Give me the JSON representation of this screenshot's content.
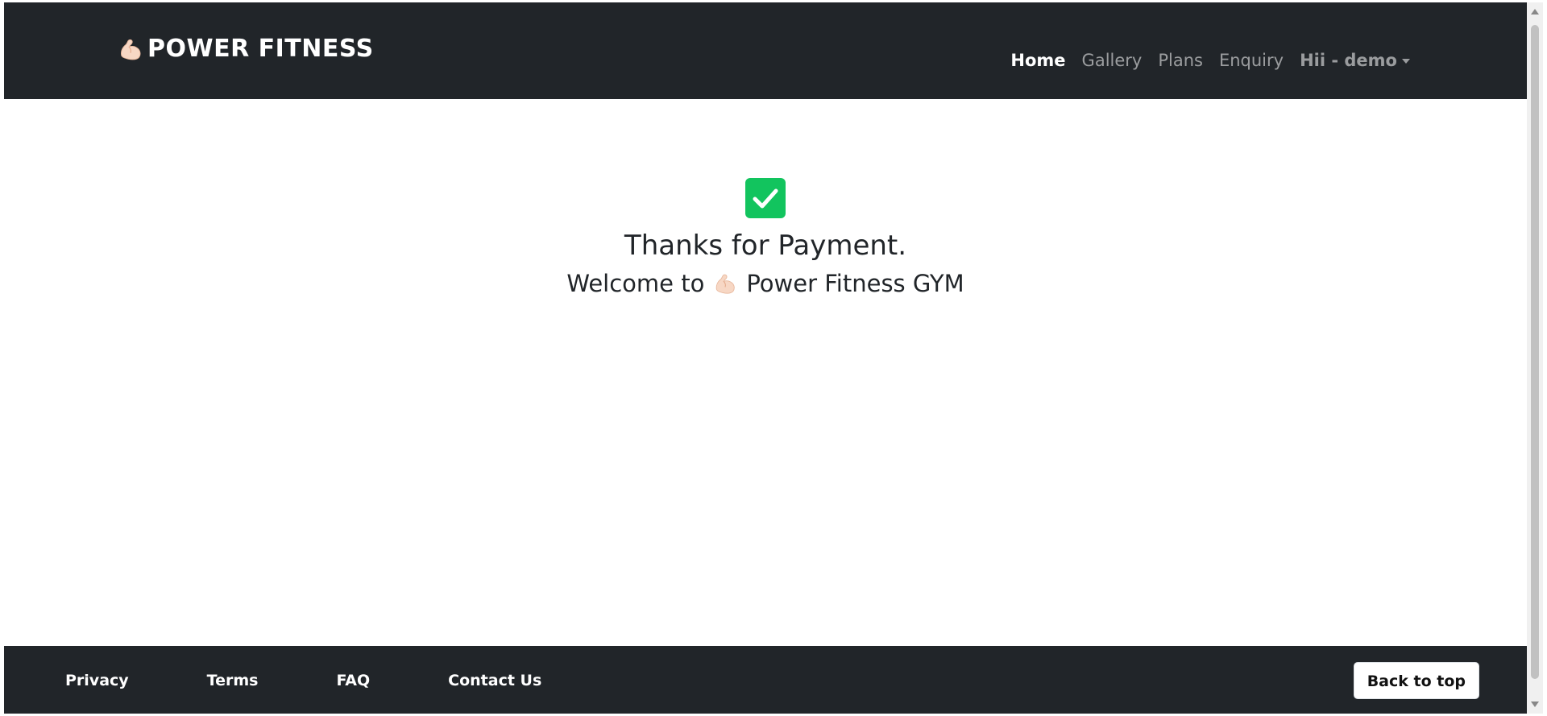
{
  "navbar": {
    "brand": "POWER FITNESS",
    "links": [
      {
        "label": "Home",
        "active": true
      },
      {
        "label": "Gallery",
        "active": false
      },
      {
        "label": "Plans",
        "active": false
      },
      {
        "label": "Enquiry",
        "active": false
      }
    ],
    "user_menu": "Hii - demo"
  },
  "main": {
    "status_icon": "check-square-icon",
    "heading": "Thanks for Payment.",
    "welcome_prefix": "Welcome to",
    "welcome_name": "Power Fitness GYM"
  },
  "footer": {
    "links": [
      {
        "label": "Privacy"
      },
      {
        "label": "Terms"
      },
      {
        "label": "FAQ"
      },
      {
        "label": "Contact Us"
      }
    ],
    "back_to_top": "Back to top"
  },
  "colors": {
    "navbar_bg": "#212529",
    "success_green": "#12c45e",
    "arm_skin": "#f7d7c4"
  }
}
